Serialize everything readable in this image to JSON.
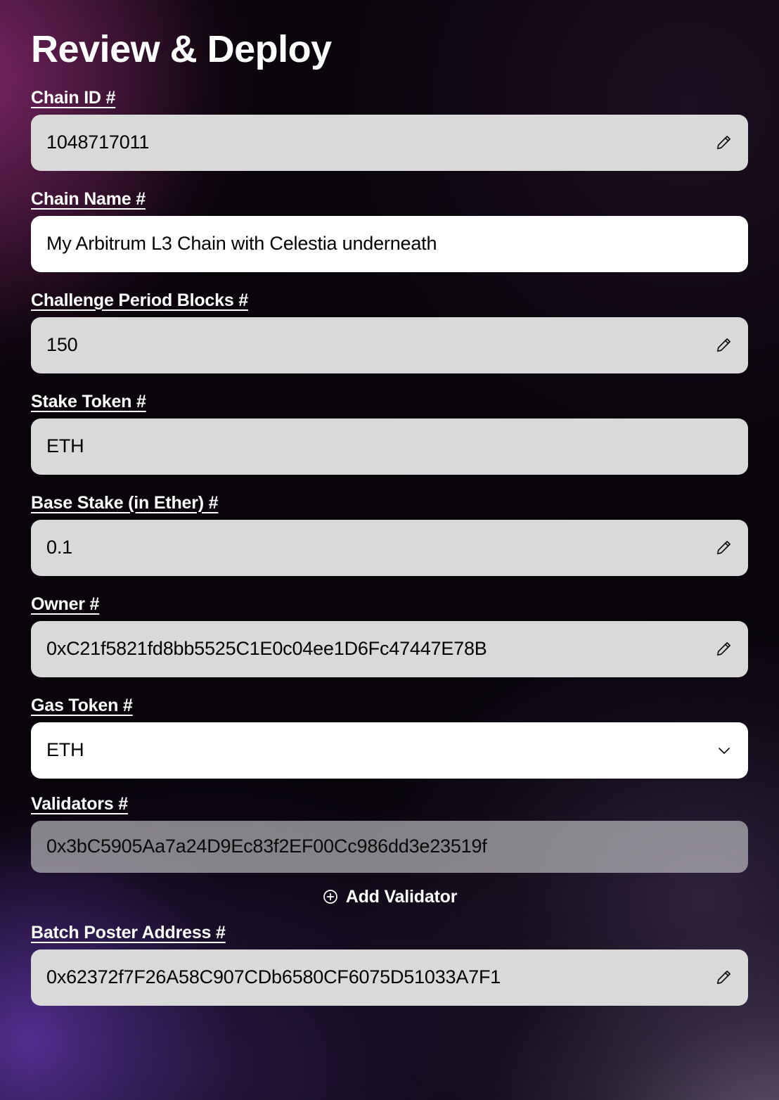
{
  "page": {
    "title": "Review & Deploy"
  },
  "colors": {
    "field_bg": "#d9d9d9",
    "field_bg_active": "#ffffff",
    "field_bg_muted": "#84808e",
    "text_on_field": "#000000",
    "label": "#ffffff",
    "bg_glow_magenta": "#802868",
    "bg_glow_violet": "#5c34a0",
    "bg_base": "#0e0710"
  },
  "fields": [
    {
      "label": "Chain ID #",
      "value": "1048717011",
      "style": "gray",
      "icon": "pencil-icon",
      "name": "chain-id"
    },
    {
      "label": "Chain Name #",
      "value": "My Arbitrum L3 Chain with Celestia underneath",
      "style": "white",
      "icon": "none",
      "name": "chain-name"
    },
    {
      "label": "Challenge Period Blocks #",
      "value": "150",
      "style": "gray",
      "icon": "pencil-icon",
      "name": "challenge-period-blocks"
    },
    {
      "label": "Stake Token #",
      "value": "ETH",
      "style": "gray",
      "icon": "none",
      "name": "stake-token"
    },
    {
      "label": "Base Stake (in Ether) #",
      "value": "0.1",
      "style": "gray",
      "icon": "pencil-icon",
      "name": "base-stake"
    },
    {
      "label": "Owner #",
      "value": "0xC21f5821fd8bb5525C1E0c04ee1D6Fc47447E78B",
      "style": "gray",
      "icon": "pencil-icon",
      "name": "owner"
    },
    {
      "label": "Gas Token #",
      "value": "ETH",
      "style": "white",
      "icon": "chevron-down-icon",
      "name": "gas-token"
    },
    {
      "label": "Validators #",
      "value": "0x3bC5905Aa7a24D9Ec83f2EF00Cc986dd3e23519f",
      "style": "muted",
      "icon": "none",
      "name": "validator-0"
    },
    {
      "label": "Batch Poster Address #",
      "value": "0x62372f7F26A58C907CDb6580CF6075D51033A7F1",
      "style": "gray",
      "icon": "pencil-icon",
      "name": "batch-poster-address"
    }
  ],
  "add_validator": {
    "label": "Add Validator",
    "icon": "plus-circle-icon"
  }
}
